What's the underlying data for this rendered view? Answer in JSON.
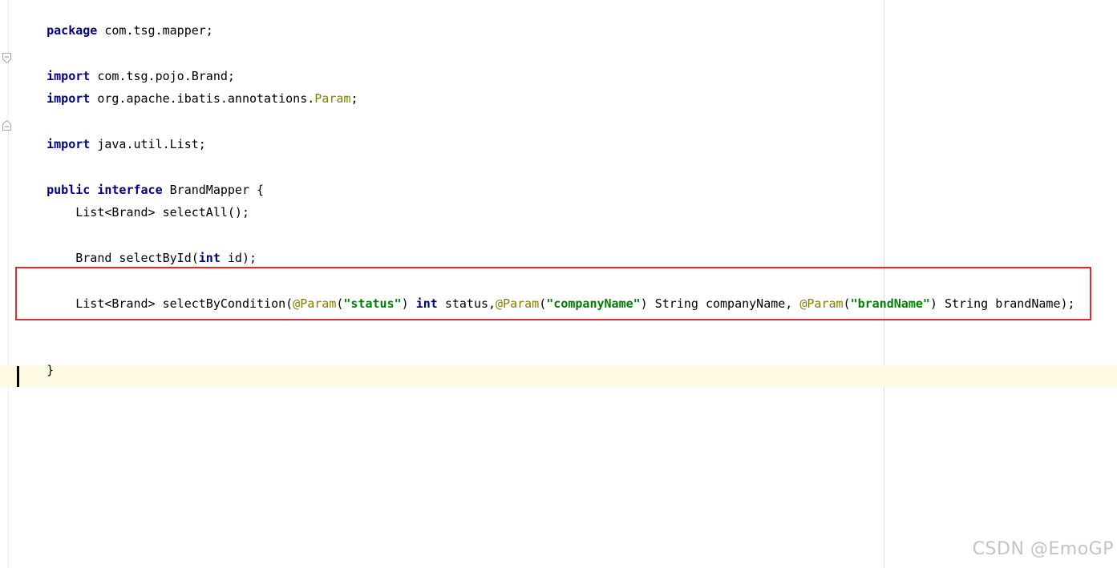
{
  "editor": {
    "lines": {
      "package": {
        "keyword": "package",
        "rest": " com.tsg.mapper;"
      },
      "import_brand": {
        "keyword": "import",
        "rest": " com.tsg.pojo.Brand;"
      },
      "import_param": {
        "keyword": "import",
        "rest": " org.apache.ibatis.annotations.",
        "annotation": "Param",
        "end": ";"
      },
      "import_list": {
        "keyword": "import",
        "rest": " java.util.List;"
      },
      "interface_decl": {
        "kw1": "public",
        "kw2": "interface",
        "rest": " BrandMapper {"
      },
      "select_all": {
        "text": "    List<Brand> selectAll();"
      },
      "select_by_id": {
        "prefix": "    Brand selectById(",
        "kw": "int",
        "suffix": " id);"
      },
      "select_by_condition": {
        "prefix": "    List<Brand> selectByCondition(",
        "ann1": "@Param",
        "open1": "(",
        "str1": "\"status\"",
        "close1": ") ",
        "kw": "int",
        "mid1": " status,",
        "ann2": "@Param",
        "open2": "(",
        "str2": "\"companyName\"",
        "mid2": ") String companyName, ",
        "ann3": "@Param",
        "open3": "(",
        "str3": "\"brandName\"",
        "end": ") String brandName);"
      },
      "closing_brace": {
        "text": "}"
      }
    },
    "colors": {
      "keyword": "#000080",
      "annotation": "#808000",
      "string": "#008000",
      "current_line": "#fefae3",
      "highlight_border": "#e32b2b"
    }
  },
  "watermark": "CSDN @EmoGP"
}
